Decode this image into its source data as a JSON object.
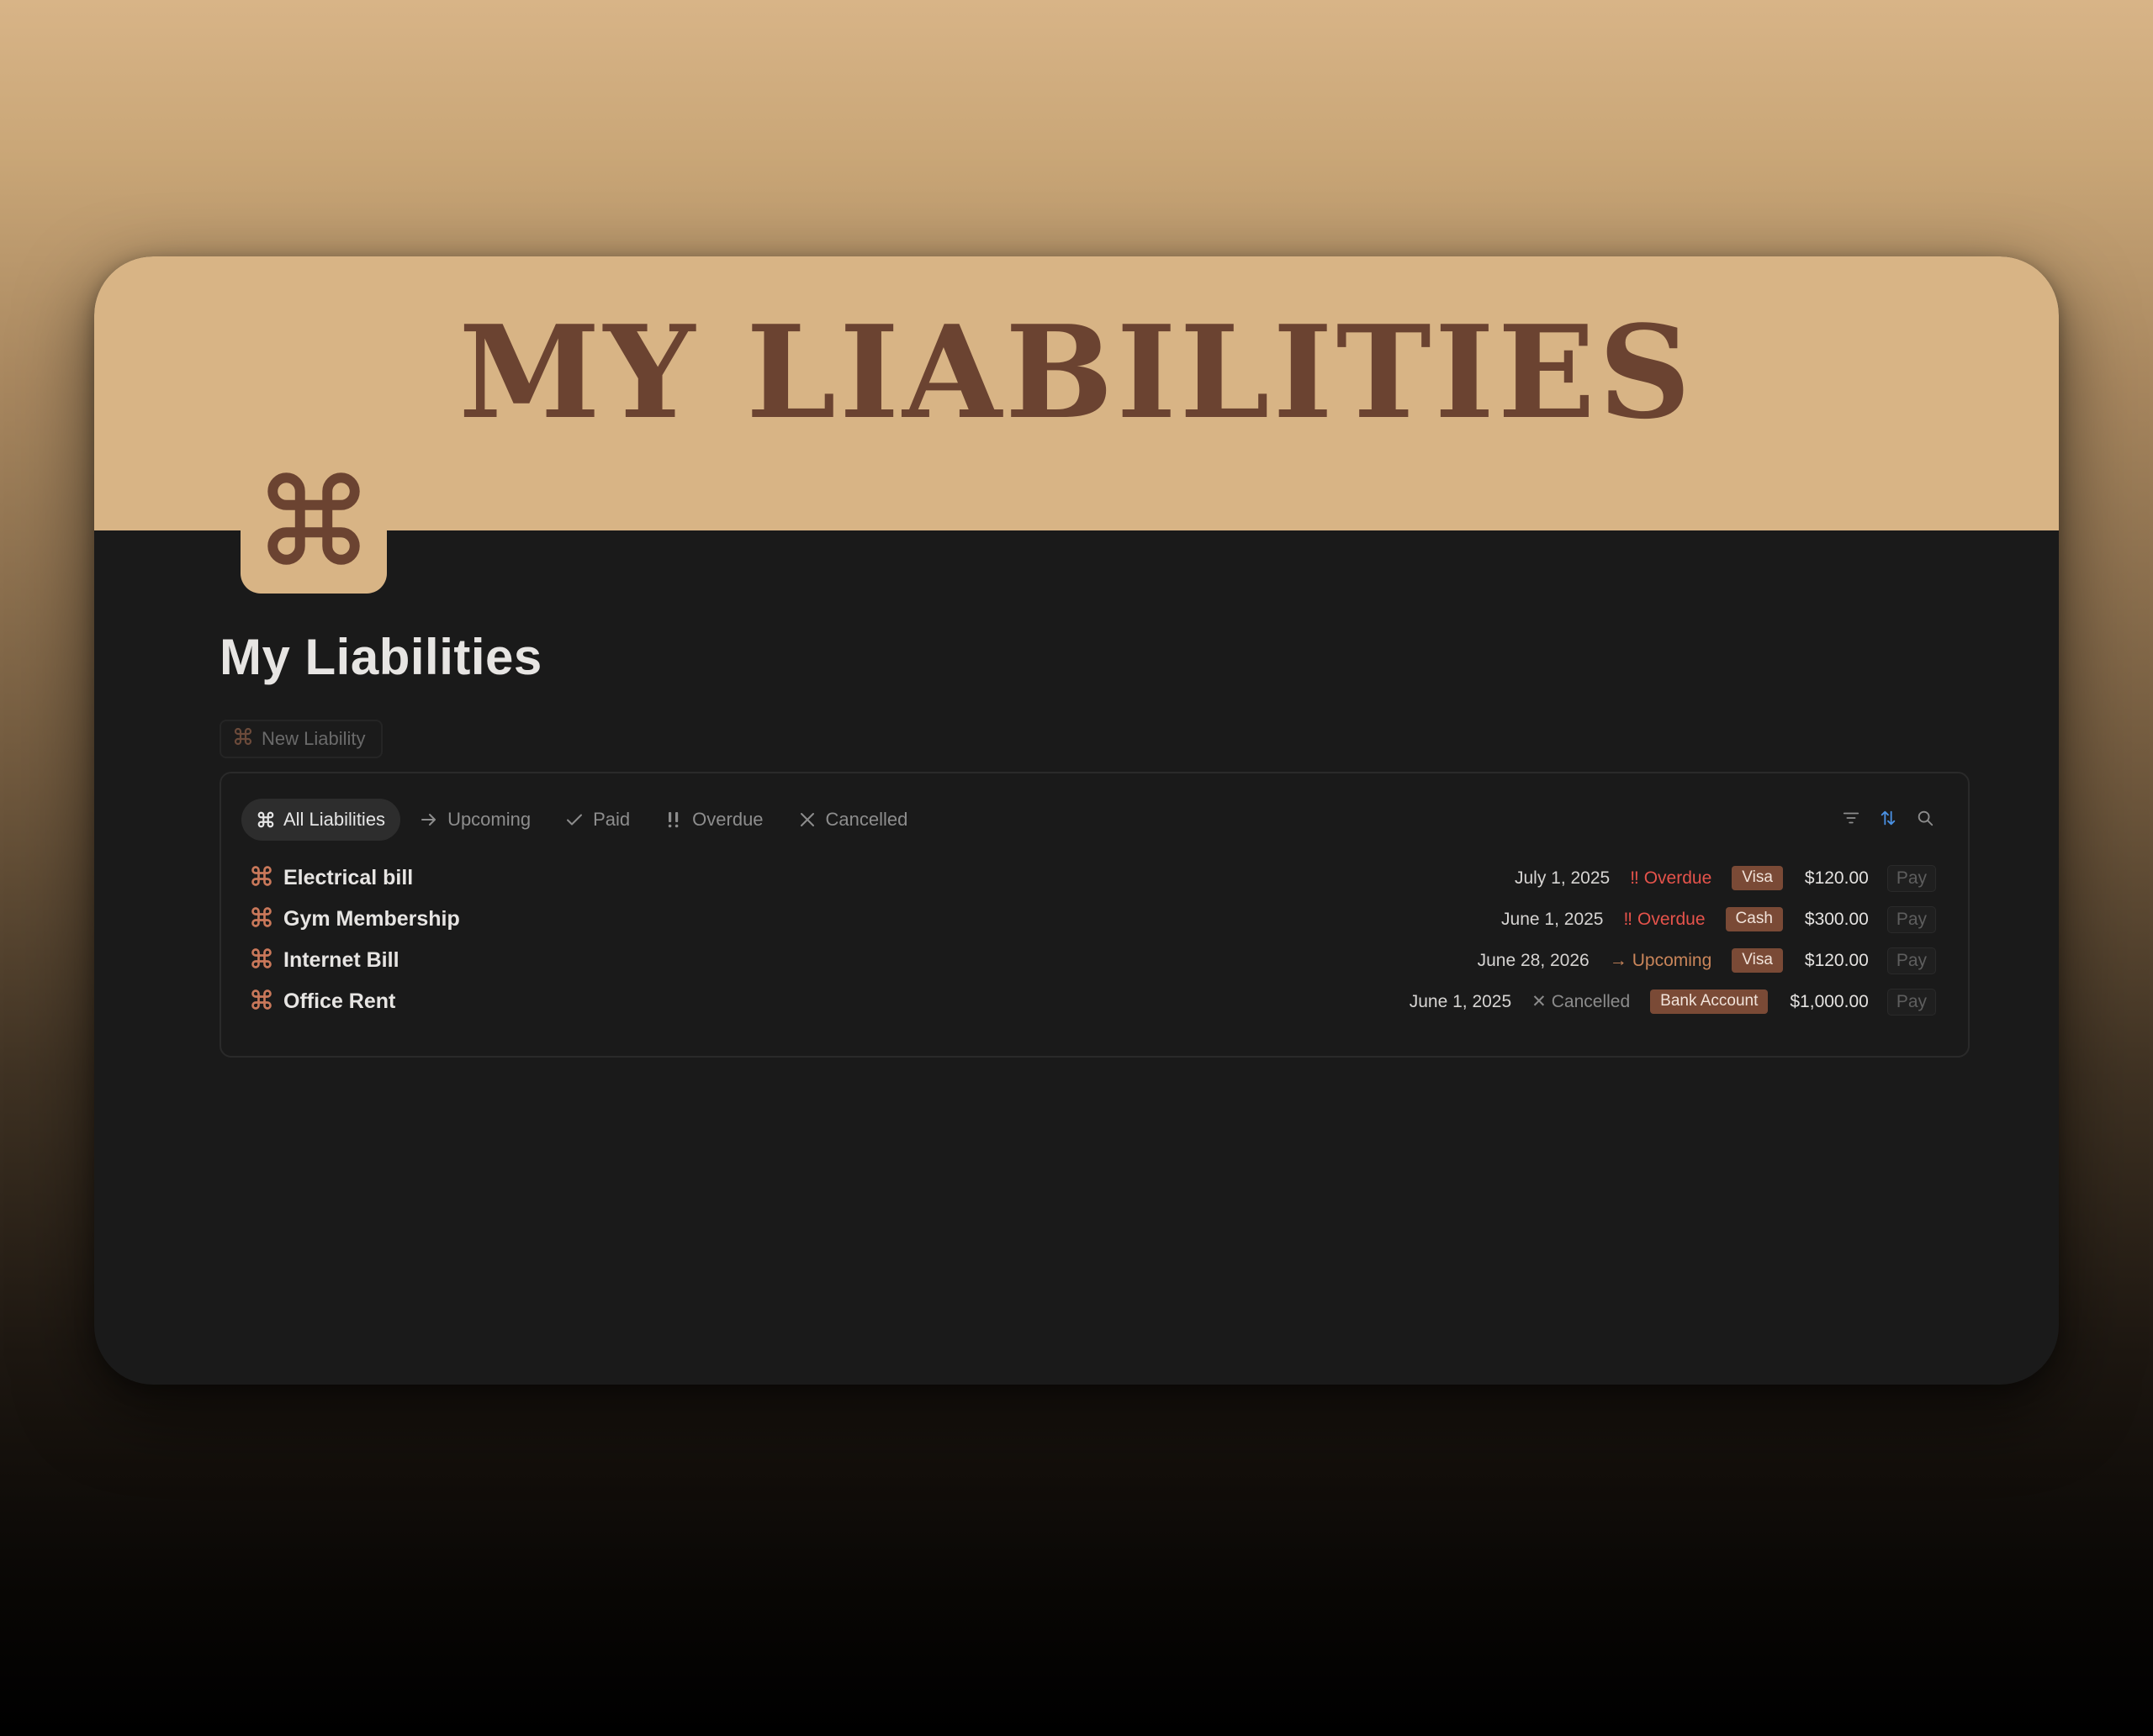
{
  "cover": {
    "title": "MY LIABILITIES"
  },
  "page": {
    "icon": "command-icon",
    "title": "My Liabilities"
  },
  "new_button": {
    "label": "New Liability",
    "icon": "command-icon"
  },
  "tabs": [
    {
      "label": "All Liabilities",
      "icon": "command-icon",
      "active": true
    },
    {
      "label": "Upcoming",
      "icon": "arrow-right-icon",
      "active": false
    },
    {
      "label": "Paid",
      "icon": "check-icon",
      "active": false
    },
    {
      "label": "Overdue",
      "icon": "double-exclamation-icon",
      "active": false
    },
    {
      "label": "Cancelled",
      "icon": "x-icon",
      "active": false
    }
  ],
  "toolbar": {
    "icons": [
      "filter-icon",
      "sort-icon",
      "search-icon"
    ]
  },
  "rows": [
    {
      "name": "Electrical bill",
      "date": "July 1, 2025",
      "status": "Overdue",
      "status_symbol": "‼",
      "method": "Visa",
      "amount": "$120.00",
      "action": "Pay"
    },
    {
      "name": "Gym Membership",
      "date": "June 1, 2025",
      "status": "Overdue",
      "status_symbol": "‼",
      "method": "Cash",
      "amount": "$300.00",
      "action": "Pay"
    },
    {
      "name": "Internet Bill",
      "date": "June 28, 2026",
      "status": "Upcoming",
      "status_symbol": "→",
      "method": "Visa",
      "amount": "$120.00",
      "action": "Pay"
    },
    {
      "name": "Office Rent",
      "date": "June 1, 2025",
      "status": "Cancelled",
      "status_symbol": "✕",
      "method": "Bank Account",
      "amount": "$1,000.00",
      "action": "Pay"
    }
  ],
  "colors": {
    "accent": "#d8b485",
    "accent_dark": "#6b4331",
    "overdue": "#e5534b",
    "upcoming": "#c9855a",
    "tag": "#7a4a36",
    "sort_icon": "#4a90e2"
  }
}
